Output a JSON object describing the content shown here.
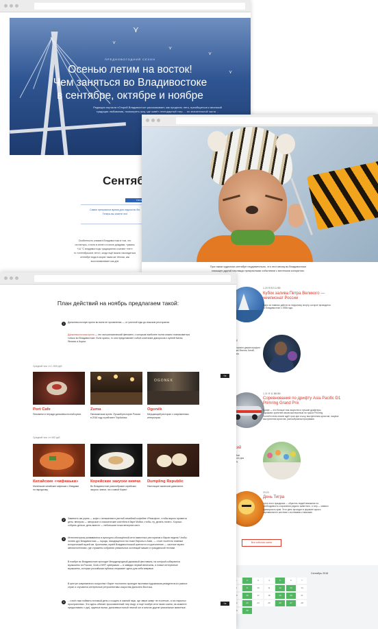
{
  "hero": {
    "small_label": "ПРЕДНОВОГОДНИЙ СЕЗОН",
    "title": "Осенью летим на восток!\nЧем заняться во Владивостоке\nв сентябре, октябре и ноябре",
    "lead": "Редакция портала «Открой Владивосток» рассказывает, как продлить лето, приобщиться к японской традиции любования, посмотреть шоу, где живёт легендарный тигр, …по значительной части…"
  },
  "section1": {
    "heading": "Сентябр",
    "pill": "Сентябрь",
    "blue_text": "Самое прекрасное время для отдыха во Вл.\nТеперь вы знаете это!",
    "body": "Особенность климата Владивостока в том, что\nна нагнусь, и если в июне и в июле дождями, туманы\n+14 °C владивостоцы традиционно считают «нет»\nто «сентябрьское лето», когда ещё можно насладиться\nсентябре вода в морях такая же тёплая, как\nвосстанавливает как для"
  },
  "photo_window": {
    "caption": "При таком чудесном сентябре неудивительно, что этот месяц во Владивостоке\nнасыщен другой наслажди прекрасными событиями с местными колоритом."
  },
  "plan": {
    "title": "План действий на ноябрь предлагаем такой:",
    "step1_text": "Дальневосточную кухню во всем ее проявлении — от уличной еды до изысков ресторанов.",
    "step1_sub_link": "Дальневосточная кухня",
    "step1_sub": "— это гастрономический феномен, с которым наиболее полно можно познакомиться только во Владивостоке. Если кратко, то она представляет собой сочетание дикоросов с кухней Китая, Японии и Кореи.",
    "avg_check_1": "Средний чек: от 1 500 руб.",
    "avg_check_2": "Средний чек: от 400 руб.",
    "share_label": "f  в",
    "cards_row1": [
      {
        "title": "Port Cafe",
        "desc": "Пельмени в тетради дальневосточной кухни."
      },
      {
        "title": "Zuma",
        "desc": "Паназиатская кухня. Лучший ресторан России\nв 2016 году в рейтинге TripAdvisor."
      },
      {
        "title": "Ogonёk",
        "desc": "Мерцающий ресторан с современным\nинтерьером."
      }
    ],
    "cards_row2": [
      {
        "title": "Китайские «чифаньки»",
        "desc": "Маленькие китайские кафешки с блюдами\nпо народному."
      },
      {
        "title": "Корейские закуски кимчи",
        "desc": "Во Владивостоке разнообразие корейских\nзакусок: кимчи, ча и самой Кореи!"
      },
      {
        "title": "Dumpling Republic",
        "desc": "Настоящие азиатские дамплинги."
      }
    ],
    "step2_text": "Заменить им угрем — кофе с пельменем в уютной семейной кофейне «Ремсфон», чтобы вкусно провести день: вечером — авторское и классические коктейли в баре Мойка, чтобы, ну, делать ничего. Хорошо собрать деньги, день вместо — небольшая точка вечерних мест.",
    "step3_text": "Интеллектуалы развиваются в культурно-обогащённой сети известных ресторанов и баров недель! Чтобы понять дух Владивостока — города, находящегося на стыке Европы и Азии, — стоит посетить главные исторический музей им. Арсеньева, музей Владивостокской крепости и в дополнение — частные музеи автомототехники, где отражены собрания уникальных коллекций машин и гражданской техники.",
    "step3_b": "В ноябре во Владивостоке проходит Международный джазовый фестиваль, на который собираются музыканты из России, США и КНР, сумерками — в заведах первой величины, и новые интересные музыканты, которые российская публика открывает здесь для себя впервые.",
    "step3_c": "В центре современного искусства «Заря» постоянно проходят выставки художников-резидентов из разных стран и случаются интересные ретроспективы искусства Дальнего Востока.",
    "step4_text": "…и всё-таки поймать питомый день и сходить в зимний парк, где звери живут не в клетках, а на открытых пространствах. Это здесь обитает прославленный тигр Амур, в ещё ноябре сети такие сомни, на моменте предоставить с рук), крупные волки, дальневосточный лесной кот и многие другие уникальные животные."
  },
  "events": {
    "items": [
      {
        "date": "1-20 Ф ВЛ 11 ВВ",
        "title": "Кубок залива Петра Великого —\nчемпионат России",
        "desc": "Одно из главных действ по парусному спорту, которое проводится\nво Владивостоке с 1986 года."
      },
      {
        "date": "",
        "title": "он",
        "desc": "выступают демонстрируют\nтакже Япония, Китай,\nКорея"
      },
      {
        "date": "1-21 Ф 11 ВВ ВВ",
        "title": "Соревнования по дрифту Asia Pacific D1\nPrimring Grand Prix",
        "desc": "Дрифт — это больше чем искусство и лучшие дрифтеры.\nпоражают зрителей своим мастерством на трассе Primring.\nГостей в этом сезоне ждёт гран-при и шоу, выступления артистов, покупки\nвыступления артистов, разнообразная программа."
      },
      {
        "date": "",
        "title": "ский",
        "desc": "любые\nявного дня\nонец"
      },
      {
        "date": "23-24",
        "title": "День Тигра",
        "desc": "Цель этого праздника — обратить людей внимание на\nнеобходимость сохранения редкого животного, а тигр — символ\nприморского края. Этот день проходит в формате яркого\nкарнавального шествия с костюмами и масками."
      }
    ],
    "button": "Все события осени"
  },
  "calendar": {
    "month": "Сентябрь 2018",
    "days": [
      "1",
      "2",
      "3",
      "4",
      "5",
      "6",
      "7",
      "8",
      "9",
      "10",
      "11",
      "12",
      "13",
      "14",
      "15",
      "16",
      "17",
      "18",
      "19",
      "20",
      "21",
      "22",
      "23",
      "24",
      "25",
      "26",
      "27",
      "28",
      "29",
      "30"
    ]
  },
  "colors": {
    "accent_red": "#d9392b",
    "link_blue": "#2d63b8",
    "calendar_green": "#52b663"
  }
}
